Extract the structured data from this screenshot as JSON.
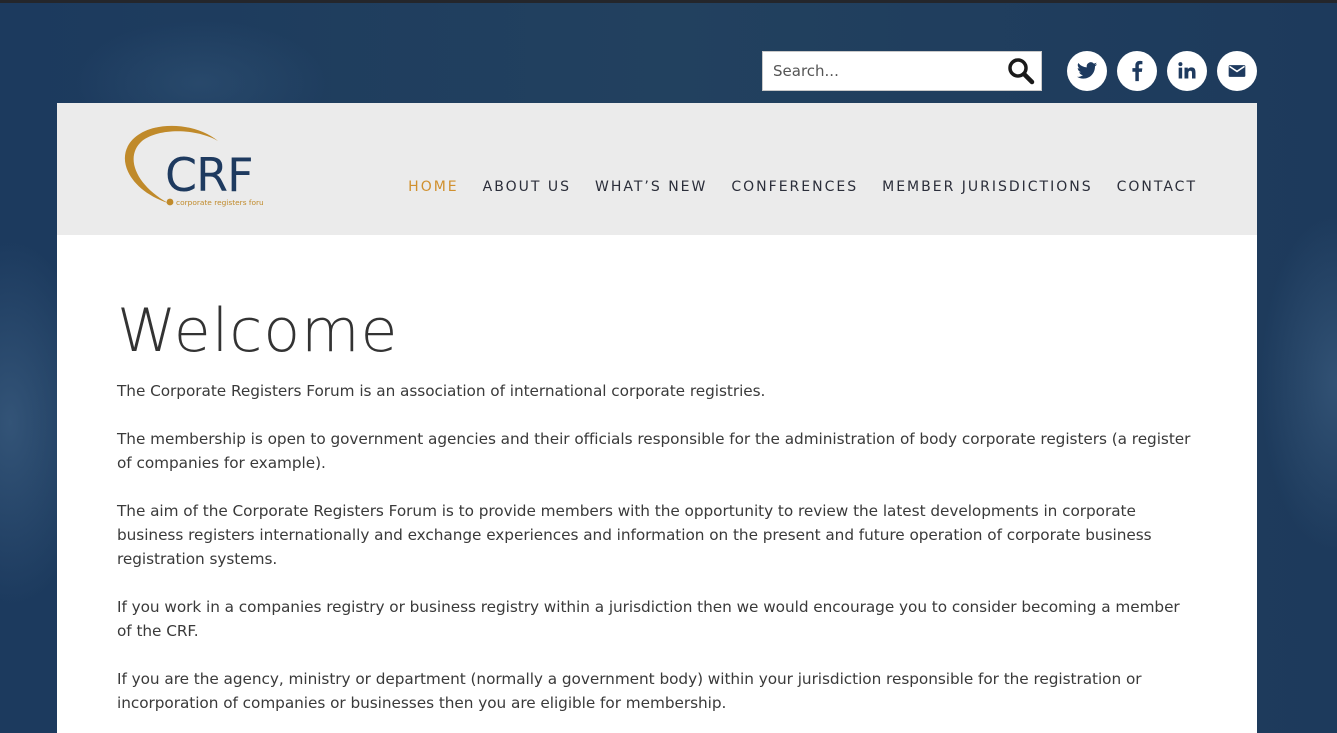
{
  "search": {
    "placeholder": "Search..."
  },
  "social": [
    "twitter",
    "facebook",
    "linkedin",
    "email"
  ],
  "logo": {
    "letters": "CRF",
    "tagline": "corporate registers forum"
  },
  "nav": [
    {
      "label": "HOME",
      "active": true
    },
    {
      "label": "ABOUT US",
      "active": false
    },
    {
      "label": "WHAT’S NEW",
      "active": false
    },
    {
      "label": "CONFERENCES",
      "active": false
    },
    {
      "label": "MEMBER JURISDICTIONS",
      "active": false
    },
    {
      "label": "CONTACT",
      "active": false
    }
  ],
  "main": {
    "title": "Welcome",
    "paragraphs": [
      "The Corporate Registers Forum is an association of international corporate registries.",
      "The membership is open to government agencies and their officials responsible for the administration of body corporate registers (a register of companies for example).",
      "The aim of the Corporate Registers Forum is to provide members with the opportunity to review the latest developments in corporate business registers internationally and exchange experiences and information on the present and future operation of corporate business registration systems.",
      "If you work in a companies registry or business registry within a jurisdiction then we would encourage you to consider becoming a member of the CRF.",
      "If you are the agency, ministry or department (normally a government body) within your jurisdiction responsible for the registration or incorporation of companies or businesses then you are eligible for membership."
    ]
  },
  "colors": {
    "accent": "#d0902e",
    "brand_navy": "#1e3a5f",
    "nav_text": "#2b2e3a"
  }
}
